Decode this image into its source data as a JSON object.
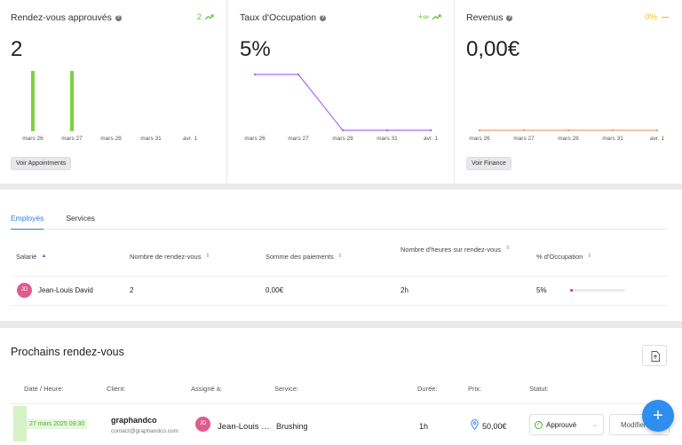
{
  "kpis": [
    {
      "title": "Rendez-vous approuvés",
      "trend": "2",
      "trend_icon": "trend-up-icon",
      "trend_color": "#5ec63c",
      "value": "2",
      "button_label": "Voir Appointments",
      "chart_type": "bar",
      "categories": [
        "mars 26",
        "mars 27",
        "mars 28",
        "mars 31",
        "avr. 1"
      ],
      "values": [
        1,
        1,
        0,
        0,
        0
      ],
      "color": "#7dd13f"
    },
    {
      "title": "Taux d'Occupation",
      "trend": "+∞",
      "trend_icon": "trend-up-icon",
      "trend_color": "#5ec63c",
      "value": "5%",
      "chart_type": "line",
      "categories": [
        "mars 26",
        "mars 27",
        "mars 28",
        "mars 31",
        "avr. 1"
      ],
      "values": [
        10,
        10,
        0,
        0,
        0
      ],
      "color": "#a66cf0"
    },
    {
      "title": "Revenus",
      "trend": "0%",
      "trend_icon": "trend-flat-icon",
      "trend_color": "#f2c22f",
      "value": "0,00€",
      "button_label": "Voir Finance",
      "chart_type": "line",
      "categories": [
        "mars 26",
        "mars 27",
        "mars 28",
        "mars 31",
        "avr. 1"
      ],
      "values": [
        0,
        0,
        0,
        0,
        0
      ],
      "color": "#f0a070"
    }
  ],
  "chart_data": [
    {
      "type": "bar",
      "categories": [
        "mars 26",
        "mars 27",
        "mars 28",
        "mars 31",
        "avr. 1"
      ],
      "values": [
        1,
        1,
        0,
        0,
        0
      ],
      "title": "Rendez-vous approuvés"
    },
    {
      "type": "line",
      "categories": [
        "mars 26",
        "mars 27",
        "mars 28",
        "mars 31",
        "avr. 1"
      ],
      "values": [
        10,
        10,
        0,
        0,
        0
      ],
      "title": "Taux d'Occupation"
    },
    {
      "type": "line",
      "categories": [
        "mars 26",
        "mars 27",
        "mars 28",
        "mars 31",
        "avr. 1"
      ],
      "values": [
        0,
        0,
        0,
        0,
        0
      ],
      "title": "Revenus"
    }
  ],
  "employees": {
    "tabs": [
      {
        "label": "Employés",
        "active": true
      },
      {
        "label": "Services",
        "active": false
      }
    ],
    "columns": {
      "employee": "Salarié",
      "appointments": "Nombre de rendez-vous",
      "payments": "Somme des paiements",
      "hours": "Nombre d'heures sur rendez-vous",
      "occupation": "% d'Occupation"
    },
    "rows": [
      {
        "initials": "JD",
        "name": "Jean-Louis David",
        "appointments": "2",
        "payments": "0,00€",
        "hours": "2h",
        "occupation": "5%",
        "occupation_fraction": 0.05
      }
    ]
  },
  "upcoming": {
    "title": "Prochains rendez-vous",
    "columns": {
      "date": "Date / Heure:",
      "client": "Client:",
      "assigned": "Assigné à:",
      "service": "Service:",
      "duration": "Durée:",
      "price": "Prix:",
      "status": "Statut:"
    },
    "rows": [
      {
        "date": "27 mars 2025 09:30",
        "client_name": "graphandco",
        "client_email": "contact@graphandco.com",
        "assignee_initials": "JD",
        "assignee_name": "Jean-Louis David",
        "service": "Brushing",
        "duration": "1h",
        "price": "50,00€",
        "status": "Approuvé",
        "action_label": "Modifier"
      }
    ],
    "fab_label": "+"
  }
}
